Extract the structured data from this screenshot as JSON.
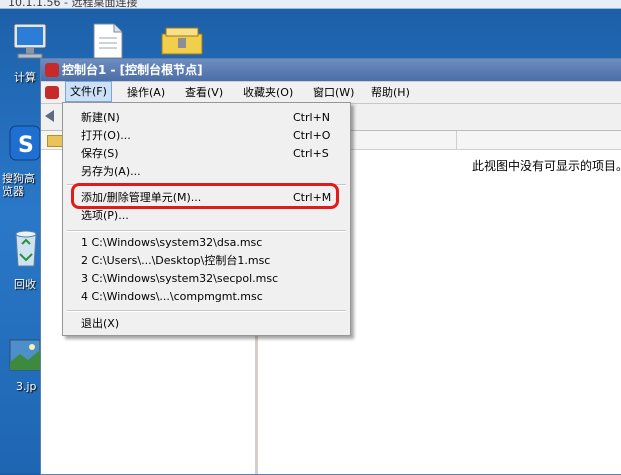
{
  "top_strip": {
    "text": "10.1.1.56 - 远程桌面连接"
  },
  "desktop": {
    "icons": [
      {
        "label": "计算"
      },
      {
        "label": "搜狗高\n览器"
      },
      {
        "label": "回收"
      },
      {
        "label": "3.jp"
      }
    ]
  },
  "window": {
    "title": "控制台1 - [控制台根节点]",
    "menubar": [
      {
        "label": "文件(F)"
      },
      {
        "label": "操作(A)"
      },
      {
        "label": "查看(V)"
      },
      {
        "label": "收藏夹(O)"
      },
      {
        "label": "窗口(W)"
      },
      {
        "label": "帮助(H)"
      }
    ],
    "empty_message": "此视图中没有可显示的项目。"
  },
  "file_menu": {
    "items": [
      {
        "label": "新建(N)",
        "shortcut": "Ctrl+N"
      },
      {
        "label": "打开(O)...",
        "shortcut": "Ctrl+O"
      },
      {
        "label": "保存(S)",
        "shortcut": "Ctrl+S"
      },
      {
        "label": "另存为(A)...",
        "shortcut": ""
      },
      {
        "label": "添加/删除管理单元(M)...",
        "shortcut": "Ctrl+M"
      },
      {
        "label": "选项(P)...",
        "shortcut": ""
      },
      {
        "label": "1 C:\\Windows\\system32\\dsa.msc",
        "shortcut": ""
      },
      {
        "label": "2 C:\\Users\\...\\Desktop\\控制台1.msc",
        "shortcut": ""
      },
      {
        "label": "3 C:\\Windows\\system32\\secpol.msc",
        "shortcut": ""
      },
      {
        "label": "4 C:\\Windows\\...\\compmgmt.msc",
        "shortcut": ""
      },
      {
        "label": "退出(X)",
        "shortcut": ""
      }
    ]
  },
  "colors": {
    "highlight_circle": "#e11b1b",
    "desktop_blue": "#1c5fa8"
  }
}
